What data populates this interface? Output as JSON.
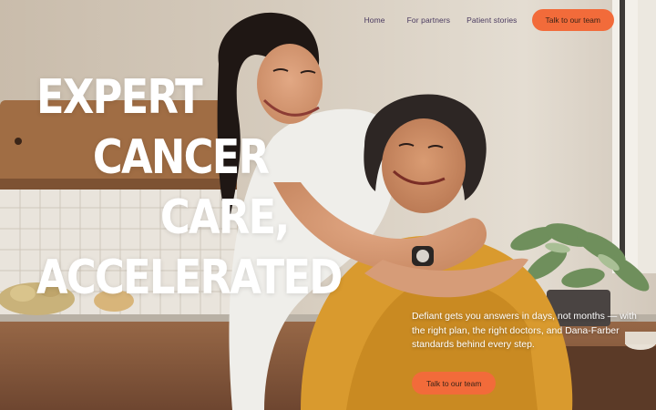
{
  "nav": {
    "links": [
      "Home",
      "For partners",
      "Patient stories"
    ],
    "cta_label": "Talk to our team"
  },
  "hero": {
    "headline_lines": [
      "EXPERT",
      "CANCER",
      "CARE,",
      "ACCELERATED"
    ],
    "subtext": "Defiant gets you answers in days, not months — with the right plan, the right doctors, and Dana-Farber standards behind every step.",
    "cta_label": "Talk to our team"
  },
  "colors": {
    "accent": "#f26b3a",
    "nav_text": "#4a3a60",
    "headline": "#ffffff"
  }
}
